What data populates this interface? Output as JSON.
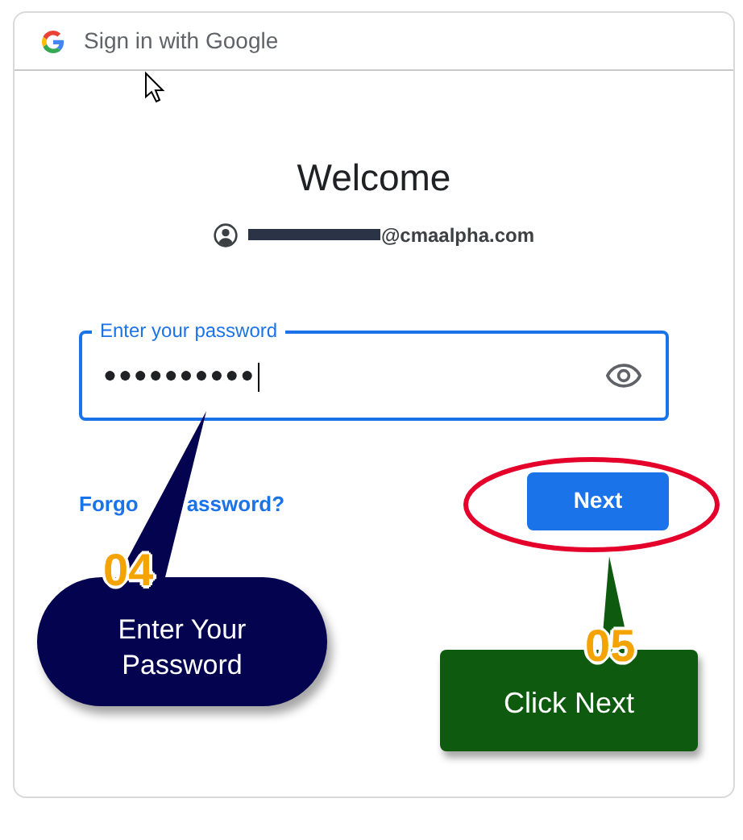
{
  "header": {
    "title": "Sign in with Google"
  },
  "heading": "Welcome",
  "account": {
    "email": "@cmaalpha.com",
    "redacted": true
  },
  "password_field": {
    "label": "Enter your password",
    "value": "●●●●●●●●●●",
    "focused": true
  },
  "forgot_link": {
    "parts": [
      "Forgo",
      "assword?"
    ]
  },
  "next_button": {
    "label": "Next"
  },
  "annotations": [
    {
      "kind": "pill",
      "step": "04",
      "text": "Enter Your Password",
      "color": "#03034f"
    },
    {
      "kind": "box",
      "step": "05",
      "text": "Click Next",
      "color": "#0e5a0e"
    }
  ]
}
